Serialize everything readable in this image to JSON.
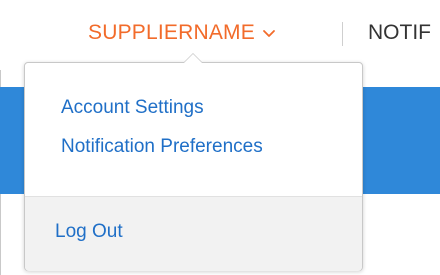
{
  "header": {
    "supplier_name": "SUPPLIERNAME",
    "notifications_label": "NOTIF"
  },
  "dropdown": {
    "items": [
      {
        "label": "Account Settings"
      },
      {
        "label": "Notification Preferences"
      }
    ],
    "logout_label": "Log Out"
  },
  "icons": {
    "supplier_menu": "chevron-down-icon"
  },
  "colors": {
    "supplier_name": "#f26b2a",
    "link": "#1f6fc7",
    "notifications": "#333333",
    "blue_band": "#2f88d9",
    "dropdown_footer": "#f2f2f2"
  }
}
